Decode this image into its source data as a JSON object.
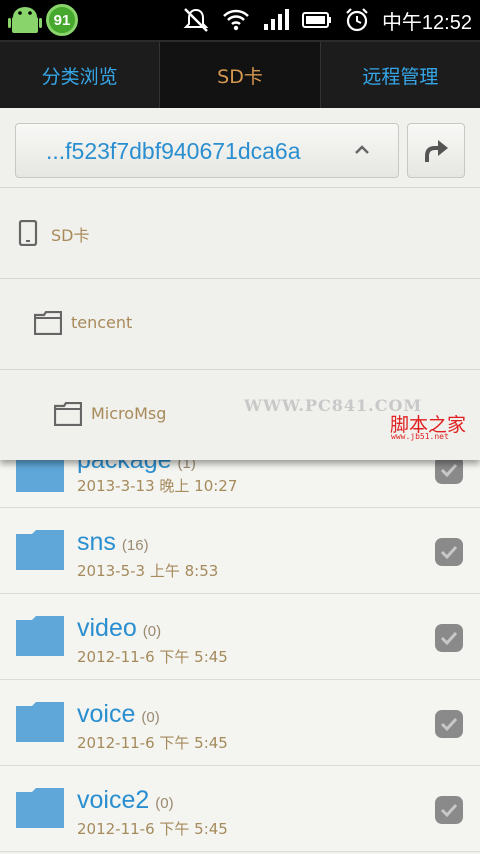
{
  "status_bar": {
    "battery_level": "91",
    "time": "中午12:52",
    "icons": [
      "android-icon",
      "battery-level-icon",
      "mute-icon",
      "wifi-icon",
      "signal-icon",
      "battery-icon",
      "alarm-icon"
    ]
  },
  "tabs": [
    {
      "label": "分类浏览",
      "active": false
    },
    {
      "label": "SD卡",
      "active": true
    },
    {
      "label": "远程管理",
      "active": false
    }
  ],
  "path_selector": {
    "current": "...f523f7dbf940671dca6a"
  },
  "path_tree": [
    {
      "label": "SD卡",
      "icon": "phone-icon"
    },
    {
      "label": "tencent",
      "icon": "folder-icon"
    },
    {
      "label": "MicroMsg",
      "icon": "folder-icon"
    }
  ],
  "files": [
    {
      "name": "package",
      "count": "(1)",
      "date": "2013-3-13 晚上 10:27"
    },
    {
      "name": "sns",
      "count": "(16)",
      "date": "2013-5-3 上午 8:53"
    },
    {
      "name": "video",
      "count": "(0)",
      "date": "2012-11-6 下午 5:45"
    },
    {
      "name": "voice",
      "count": "(0)",
      "date": "2012-11-6 下午 5:45"
    },
    {
      "name": "voice2",
      "count": "(0)",
      "date": "2012-11-6 下午 5:45"
    }
  ],
  "watermark": {
    "url": "WWW.PC841.COM",
    "logo": "脚本之家",
    "logo_sub": "www.jb51.net"
  },
  "colors": {
    "accent_blue": "#2a8fd0",
    "accent_tan": "#d59850",
    "folder_blue": "#5ea7d8"
  }
}
